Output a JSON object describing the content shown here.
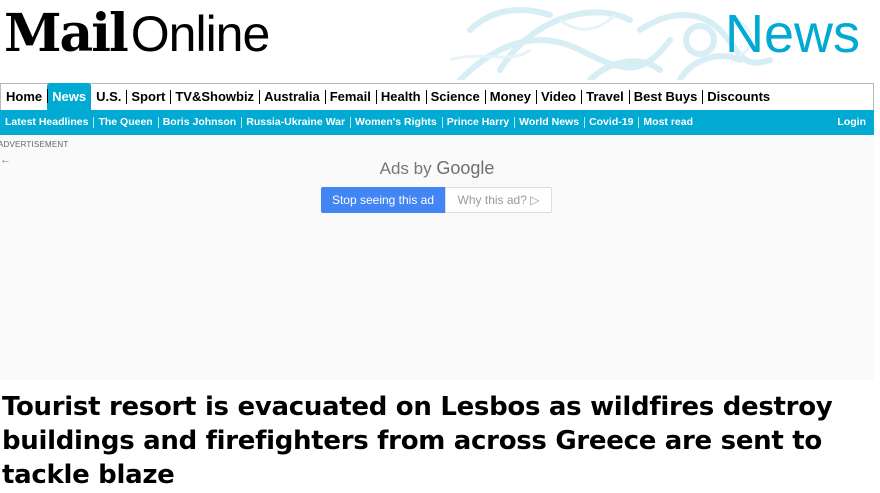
{
  "masthead": {
    "logo_mail": "Mail",
    "logo_online": "Online",
    "section_title": "News",
    "accent_color": "#00aad2"
  },
  "nav_primary": {
    "items": [
      {
        "label": "Home",
        "active": false
      },
      {
        "label": "News",
        "active": true
      },
      {
        "label": "U.S.",
        "active": false
      },
      {
        "label": "Sport",
        "active": false
      },
      {
        "label": "TV&Showbiz",
        "active": false
      },
      {
        "label": "Australia",
        "active": false
      },
      {
        "label": "Femail",
        "active": false
      },
      {
        "label": "Health",
        "active": false
      },
      {
        "label": "Science",
        "active": false
      },
      {
        "label": "Money",
        "active": false
      },
      {
        "label": "Video",
        "active": false
      },
      {
        "label": "Travel",
        "active": false
      },
      {
        "label": "Best Buys",
        "active": false
      },
      {
        "label": "Discounts",
        "active": false
      }
    ]
  },
  "nav_secondary": {
    "items": [
      "Latest Headlines",
      "The Queen",
      "Boris Johnson",
      "Russia-Ukraine War",
      "Women's Rights",
      "Prince Harry",
      "World News",
      "Covid-19",
      "Most read"
    ],
    "login_label": "Login"
  },
  "ad": {
    "label": "ADVERTISEMENT",
    "back_icon": "arrow-left-icon",
    "ads_by_prefix": "Ads by ",
    "ads_by_brand": "Google",
    "stop_label": "Stop seeing this ad",
    "why_label": "Why this ad? ▷",
    "button_color": "#4285f4"
  },
  "article": {
    "headline": "Tourist resort is evacuated on Lesbos as wildfires destroy buildings and firefighters from across Greece are sent to tackle blaze"
  }
}
